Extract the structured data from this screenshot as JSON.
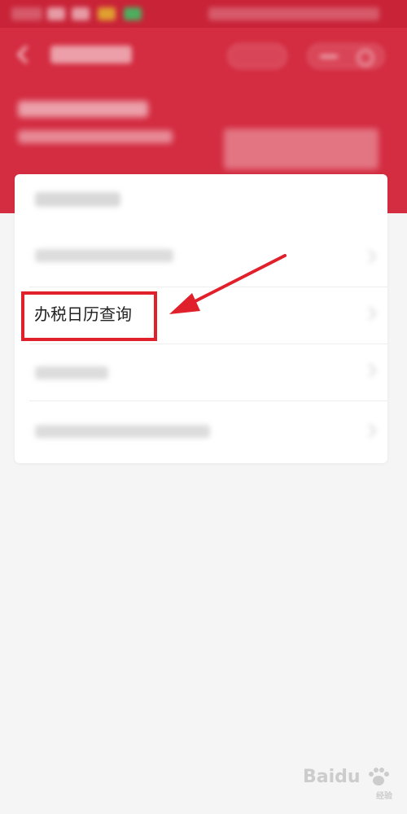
{
  "colors": {
    "header_red": "#d42c41",
    "highlight_red": "#e0202a",
    "card_bg": "#ffffff",
    "page_bg": "#f5f5f5"
  },
  "header": {
    "back_icon": "arrow-left-icon"
  },
  "card": {
    "items": [
      {
        "label": "办税日历查询",
        "highlighted": true
      }
    ]
  },
  "annotation": {
    "arrow_icon": "red-arrow-icon",
    "box": "red-highlight-box"
  },
  "watermark": {
    "logo": "Baidu",
    "sub": "经验",
    "icon": "paw-icon"
  }
}
